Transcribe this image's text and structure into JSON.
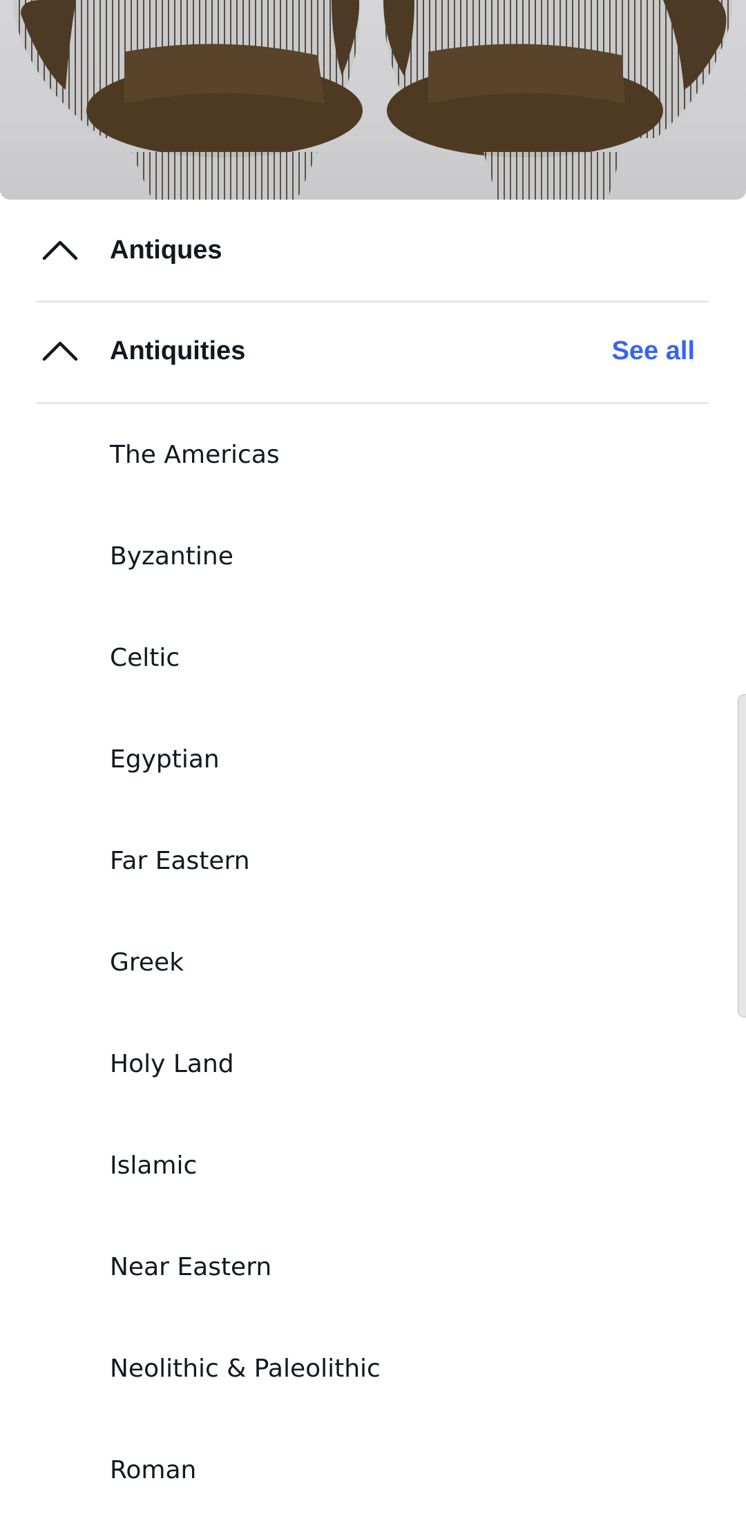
{
  "hero": {
    "icon": "chairs-photo"
  },
  "sections": [
    {
      "title": "Antiques",
      "icon": "chevron-up-icon"
    },
    {
      "title": "Antiquities",
      "icon": "chevron-up-icon",
      "see_all": "See all"
    }
  ],
  "subcategories": [
    "The Americas",
    "Byzantine",
    "Celtic",
    "Egyptian",
    "Far Eastern",
    "Greek",
    "Holy Land",
    "Islamic",
    "Near Eastern",
    "Neolithic & Paleolithic",
    "Roman"
  ],
  "colors": {
    "accent": "#3665f3",
    "text": "#111820",
    "divider": "#e5e5e5"
  }
}
